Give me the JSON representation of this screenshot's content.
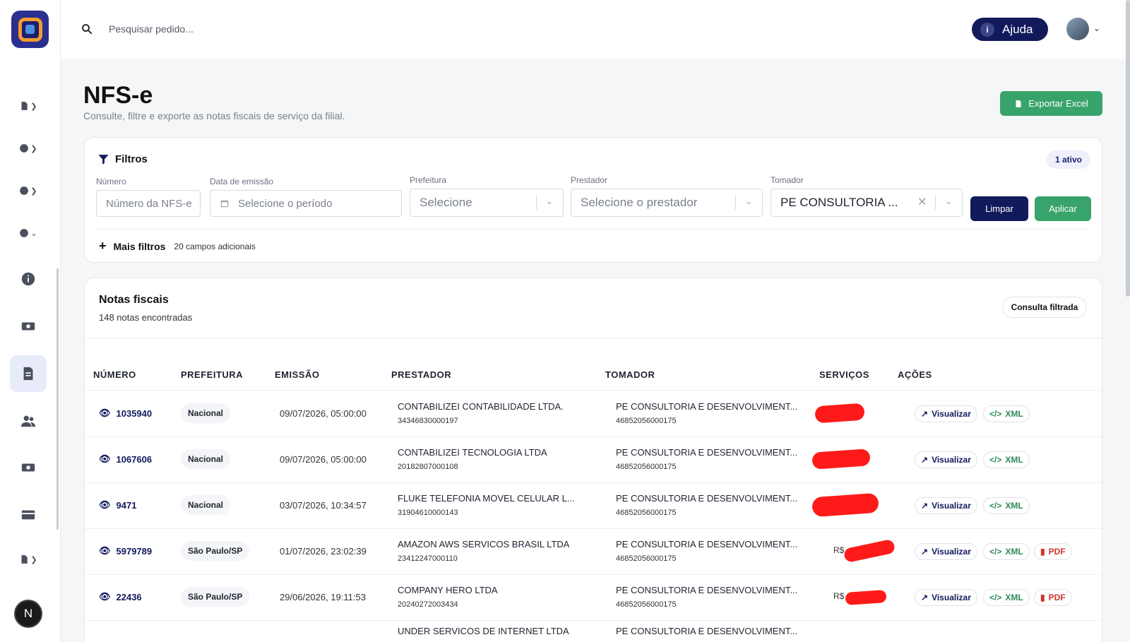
{
  "search": {
    "placeholder": "Pesquisar pedido..."
  },
  "header": {
    "help_label": "Ajuda",
    "help_icon": "i"
  },
  "sidebar": {
    "user_initial": "N"
  },
  "page": {
    "title": "NFS-e",
    "subtitle": "Consulte, filtre e exporte as notas fiscais de serviço da filial.",
    "export_label": "Exportar Excel"
  },
  "filters": {
    "title": "Filtros",
    "active_badge": "1 ativo",
    "numero": {
      "label": "Número",
      "placeholder": "Número da NFS-e"
    },
    "data": {
      "label": "Data de emissão",
      "placeholder": "Selecione o período"
    },
    "prefeitura": {
      "label": "Prefeitura",
      "value": "Selecione"
    },
    "prestador": {
      "label": "Prestador",
      "value": "Selecione o prestador"
    },
    "tomador": {
      "label": "Tomador",
      "value": "PE CONSULTORIA ..."
    },
    "clear_label": "Limpar",
    "apply_label": "Aplicar",
    "more_label": "Mais filtros",
    "more_hint": "20 campos adicionais"
  },
  "notes": {
    "title": "Notas fiscais",
    "count": "148 notas encontradas",
    "consulta_label": "Consulta filtrada",
    "columns": [
      "NÚMERO",
      "PREFEITURA",
      "EMISSÃO",
      "PRESTADOR",
      "TOMADOR",
      "SERVIÇOS",
      "AÇÕES"
    ],
    "actions": {
      "view": "Visualizar",
      "xml": "XML",
      "pdf": "PDF"
    },
    "rows": [
      {
        "numero": "1035940",
        "prefeitura": "Nacional",
        "emissao": "09/07/2026, 05:00:00",
        "prestador": "CONTABILIZEI CONTABILIDADE LTDA.",
        "prestador_cnpj": "34346830000197",
        "tomador": "PE CONSULTORIA E DESENVOLVIMENT...",
        "tomador_cnpj": "46852056000175",
        "servicos": "",
        "pdf": false
      },
      {
        "numero": "1067606",
        "prefeitura": "Nacional",
        "emissao": "09/07/2026, 05:00:00",
        "prestador": "CONTABILIZEI TECNOLOGIA LTDA",
        "prestador_cnpj": "20182807000108",
        "tomador": "PE CONSULTORIA E DESENVOLVIMENT...",
        "tomador_cnpj": "46852056000175",
        "servicos": "",
        "pdf": false
      },
      {
        "numero": "9471",
        "prefeitura": "Nacional",
        "emissao": "03/07/2026, 10:34:57",
        "prestador": "FLUKE TELEFONIA MOVEL CELULAR L...",
        "prestador_cnpj": "31904610000143",
        "tomador": "PE CONSULTORIA E DESENVOLVIMENT...",
        "tomador_cnpj": "46852056000175",
        "servicos": "",
        "pdf": false
      },
      {
        "numero": "5979789",
        "prefeitura": "São Paulo/SP",
        "emissao": "01/07/2026, 23:02:39",
        "prestador": "AMAZON AWS SERVICOS BRASIL LTDA",
        "prestador_cnpj": "23412247000110",
        "tomador": "PE CONSULTORIA E DESENVOLVIMENT...",
        "tomador_cnpj": "46852056000175",
        "servicos": "R$",
        "pdf": true
      },
      {
        "numero": "22436",
        "prefeitura": "São Paulo/SP",
        "emissao": "29/06/2026, 19:11:53",
        "prestador": "COMPANY HERO LTDA",
        "prestador_cnpj": "20240272003434",
        "tomador": "PE CONSULTORIA E DESENVOLVIMENT...",
        "tomador_cnpj": "46852056000175",
        "servicos": "R$",
        "pdf": true
      },
      {
        "numero": "",
        "prefeitura": "",
        "emissao": "",
        "prestador": "UNDER SERVICOS DE INTERNET LTDA",
        "prestador_cnpj": "",
        "tomador": "PE CONSULTORIA E DESENVOLVIMENT...",
        "tomador_cnpj": "",
        "servicos": "",
        "pdf": false
      }
    ]
  },
  "colors": {
    "navy": "#121a5c",
    "green": "#38a36b",
    "redact": "#ff1a1a"
  }
}
